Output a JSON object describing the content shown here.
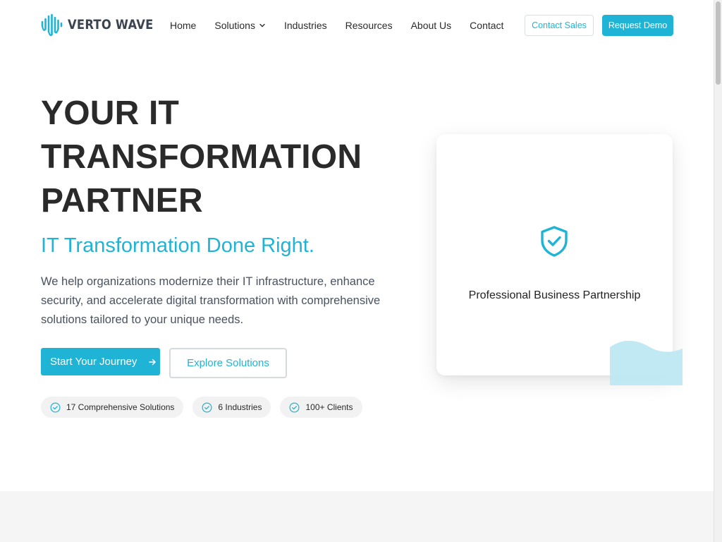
{
  "brand": {
    "name": "VERTO WAVE",
    "accent": "#1fb4d6",
    "text_dark": "#2a2a2a"
  },
  "nav": {
    "items": [
      {
        "label": "Home"
      },
      {
        "label": "Solutions",
        "icon": "chevron-down-icon"
      },
      {
        "label": "Industries"
      },
      {
        "label": "Resources"
      },
      {
        "label": "About Us"
      },
      {
        "label": "Contact"
      }
    ],
    "contact_sales": "Contact Sales",
    "request_demo": "Request Demo"
  },
  "hero": {
    "title_lines": [
      "YOUR IT",
      "TRANSFORMATION",
      "PARTNER"
    ],
    "subtitle": "IT Transformation Done Right.",
    "description": "We help organizations modernize their IT infrastructure, enhance security, and accelerate digital transformation with comprehensive solutions tailored to your unique needs.",
    "primary_cta": "Start Your Journey",
    "primary_cta_icon": "arrow-right-icon",
    "secondary_cta": "Explore Solutions",
    "stats": [
      {
        "label": "17 Comprehensive Solutions",
        "icon": "check-circle-icon"
      },
      {
        "label": "6 Industries",
        "icon": "check-circle-icon"
      },
      {
        "label": "100+ Clients",
        "icon": "check-circle-icon"
      }
    ]
  },
  "card": {
    "icon": "shield-check-icon",
    "caption": "Professional Business Partnership"
  }
}
